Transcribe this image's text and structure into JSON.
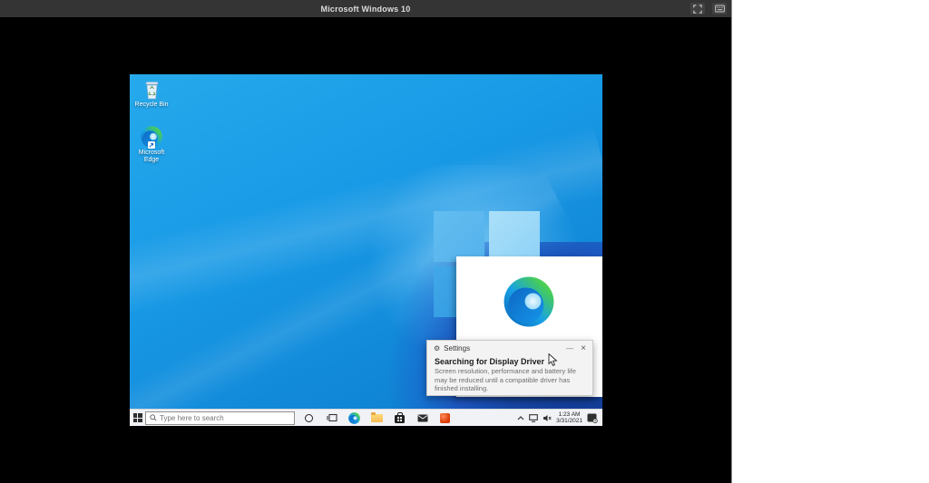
{
  "vm_window": {
    "title": "Microsoft Windows 10",
    "controls": [
      {
        "name": "fullscreen"
      },
      {
        "name": "keyboard"
      }
    ]
  },
  "desktop": {
    "icons": [
      {
        "name": "recycle-bin",
        "label": "Recycle Bin"
      },
      {
        "name": "microsoft-edge",
        "label": "Microsoft Edge"
      }
    ]
  },
  "toast": {
    "app_name": "Settings",
    "minimize_glyph": "—",
    "close_glyph": "×",
    "title": "Searching for Display Driver",
    "body": "Screen resolution, performance and battery life may be reduced until a compatible driver has finished installing."
  },
  "taskbar": {
    "search_placeholder": "Type here to search",
    "app_icons": [
      {
        "name": "cortana"
      },
      {
        "name": "task-view"
      },
      {
        "name": "edge"
      },
      {
        "name": "file-explorer"
      },
      {
        "name": "store"
      },
      {
        "name": "mail"
      },
      {
        "name": "office"
      }
    ],
    "tray": {
      "icons": [
        {
          "name": "tray-chevron"
        },
        {
          "name": "display"
        },
        {
          "name": "volume"
        },
        {
          "name": "action-center"
        }
      ],
      "time": "1:23 AM",
      "date": "3/31/2021"
    }
  },
  "colors": {
    "titlebar_bg": "#343434",
    "wallpaper_blue": "#189ae6",
    "dark_corner_blue": "#16449f",
    "taskbar_bg": "#f0f2f6",
    "toast_bg": "#f3f3f3",
    "office_orange": "#d83b01"
  }
}
